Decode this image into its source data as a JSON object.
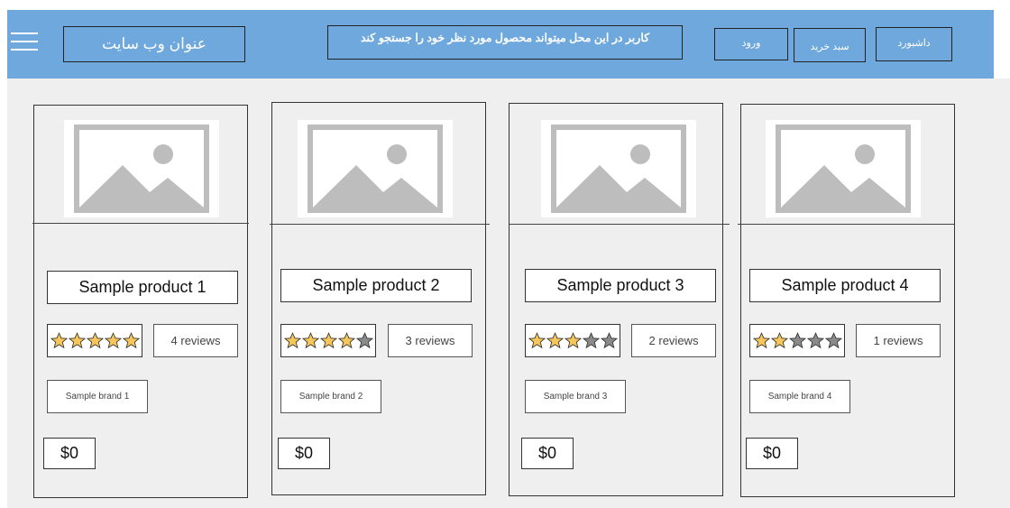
{
  "header": {
    "menu_icon": "hamburger-menu-icon",
    "site_title": "عنوان وب سایت",
    "search_text": "کاربر در این محل میتواند محصول مورد نظر خود را جستجو کند",
    "nav": {
      "login": "ورود",
      "cart": "سبد خرید",
      "dashboard": "داشبورد"
    }
  },
  "colors": {
    "header_bg": "#6fa8dc",
    "content_bg": "#efefef",
    "star_filled": "#f6c65b",
    "star_empty": "#8a8a8a"
  },
  "products": [
    {
      "name": "Sample product 1",
      "rating": 5,
      "reviews": "4 reviews",
      "brand": "Sample brand 1",
      "price": "$0",
      "image_icon": "image-placeholder-icon"
    },
    {
      "name": "Sample product 2",
      "rating": 4,
      "reviews": "3 reviews",
      "brand": "Sample brand 2",
      "price": "$0",
      "image_icon": "image-placeholder-icon"
    },
    {
      "name": "Sample product 3",
      "rating": 3,
      "reviews": "2 reviews",
      "brand": "Sample brand 3",
      "price": "$0",
      "image_icon": "image-placeholder-icon"
    },
    {
      "name": "Sample product 4",
      "rating": 2,
      "reviews": "1 reviews",
      "brand": "Sample brand 4",
      "price": "$0",
      "image_icon": "image-placeholder-icon"
    }
  ]
}
